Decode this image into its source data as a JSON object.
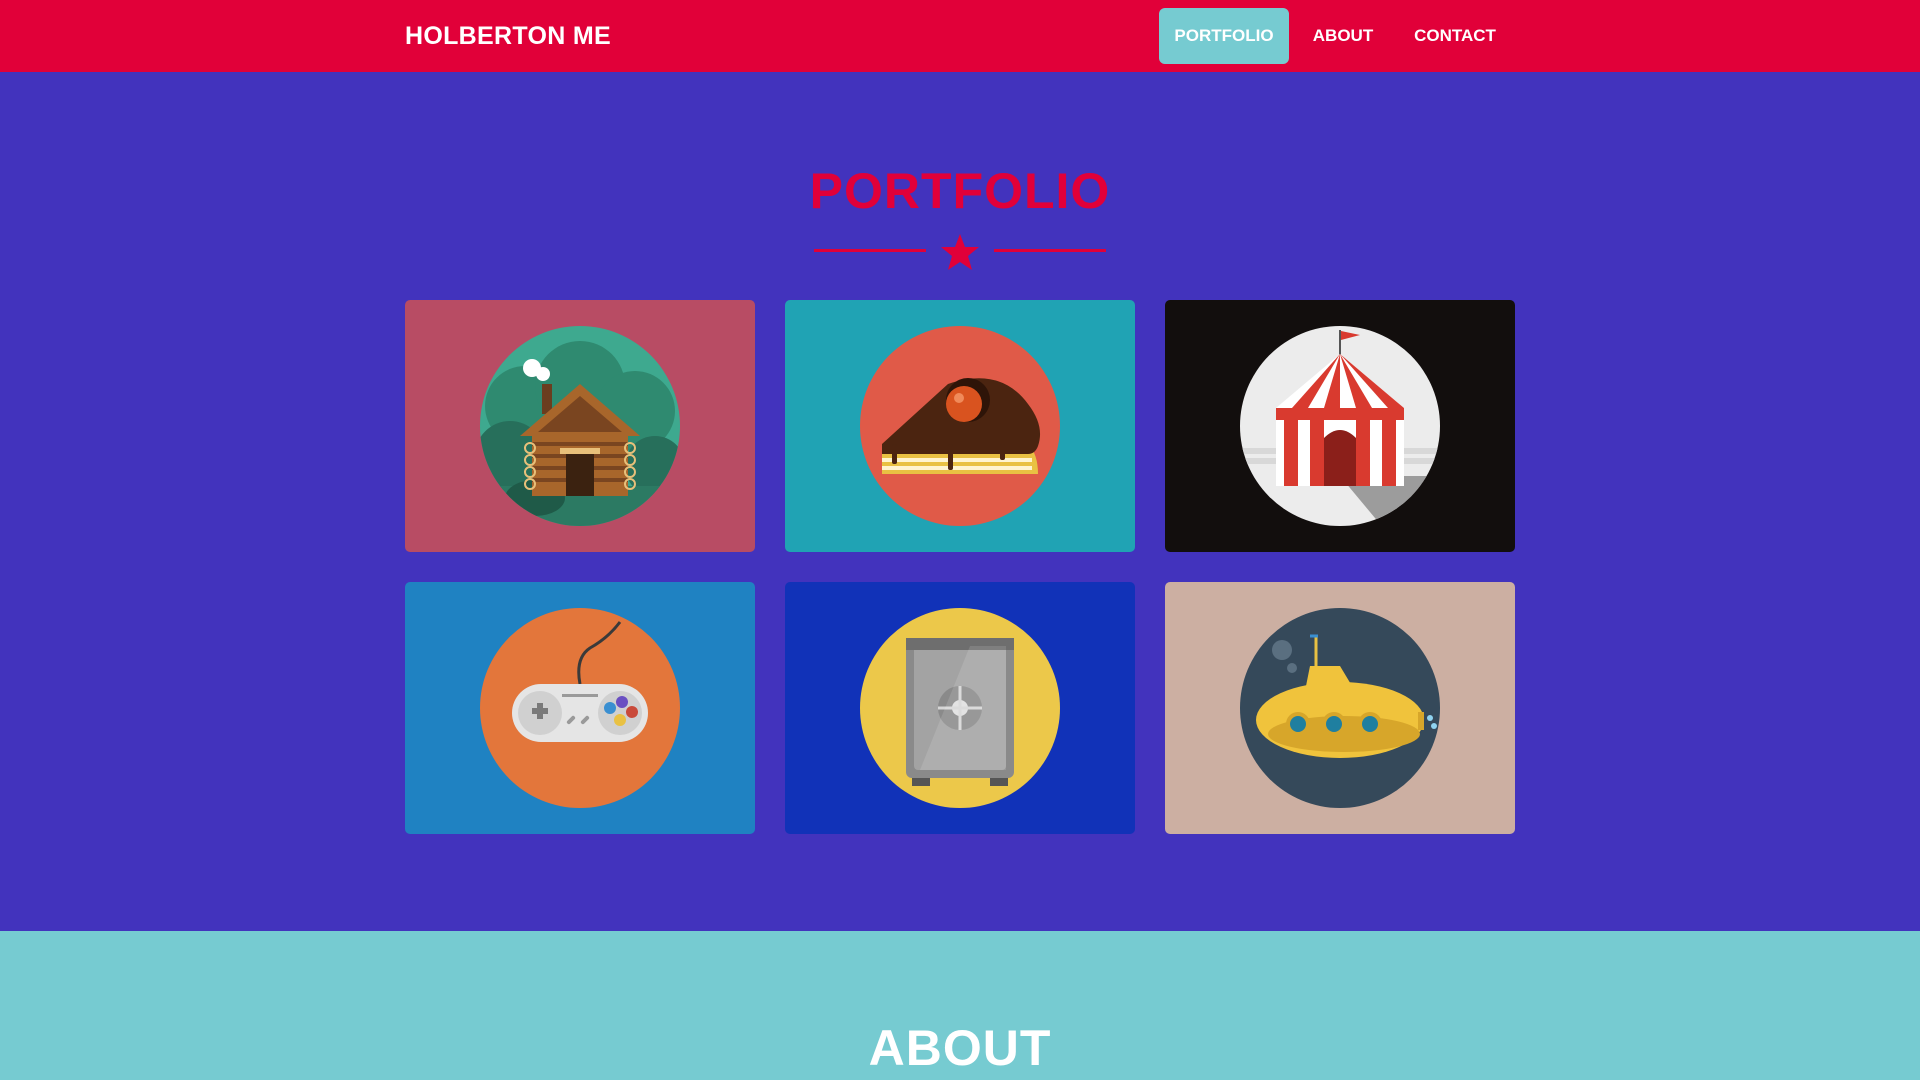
{
  "navbar": {
    "brand": "HOLBERTON ME",
    "items": [
      {
        "label": "PORTFOLIO",
        "active": true
      },
      {
        "label": "ABOUT",
        "active": false
      },
      {
        "label": "CONTACT",
        "active": false
      }
    ]
  },
  "portfolio": {
    "title": "PORTFOLIO",
    "divider_icon": "star-icon",
    "tiles": [
      {
        "icon": "cabin-icon",
        "background": "#b84c64",
        "circle": "#3ea98f"
      },
      {
        "icon": "cake-icon",
        "background": "#20a3b4",
        "circle": "#e05a48"
      },
      {
        "icon": "circus-tent-icon",
        "background": "#120e0d",
        "circle": "#ececec"
      },
      {
        "icon": "game-controller-icon",
        "background": "#1f82c2",
        "circle": "#e3763b"
      },
      {
        "icon": "safe-icon",
        "background": "#1132b8",
        "circle": "#ecc84a"
      },
      {
        "icon": "submarine-icon",
        "background": "#ccafa2",
        "circle": "#35495a"
      }
    ]
  },
  "about": {
    "title": "ABOUT"
  },
  "colors": {
    "navbar": "#e10039",
    "page_background": "#4233bd",
    "accent": "#76cbd1",
    "title_red": "#e10039"
  }
}
